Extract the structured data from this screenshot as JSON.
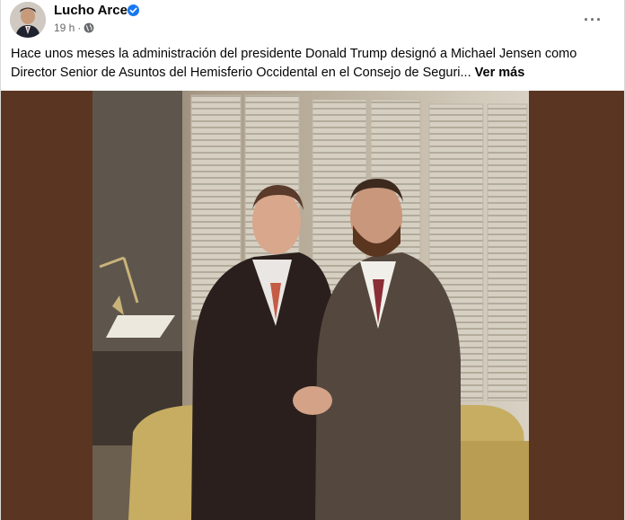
{
  "post": {
    "author": "Lucho Arce",
    "time": "19 h",
    "separator": "·",
    "more_icon": "···",
    "text": "Hace unos meses la administración del presidente Donald Trump designó a Michael Jensen como Director Senior de Asuntos del Hemisferio Occidental en el Consejo de Seguri...",
    "see_more": "Ver más"
  },
  "colors": {
    "verified": "#1877f2",
    "image_bg": "#5a3521",
    "meta": "#65676b"
  },
  "icons": [
    "verified-badge-icon",
    "globe-icon",
    "more-options-icon"
  ]
}
